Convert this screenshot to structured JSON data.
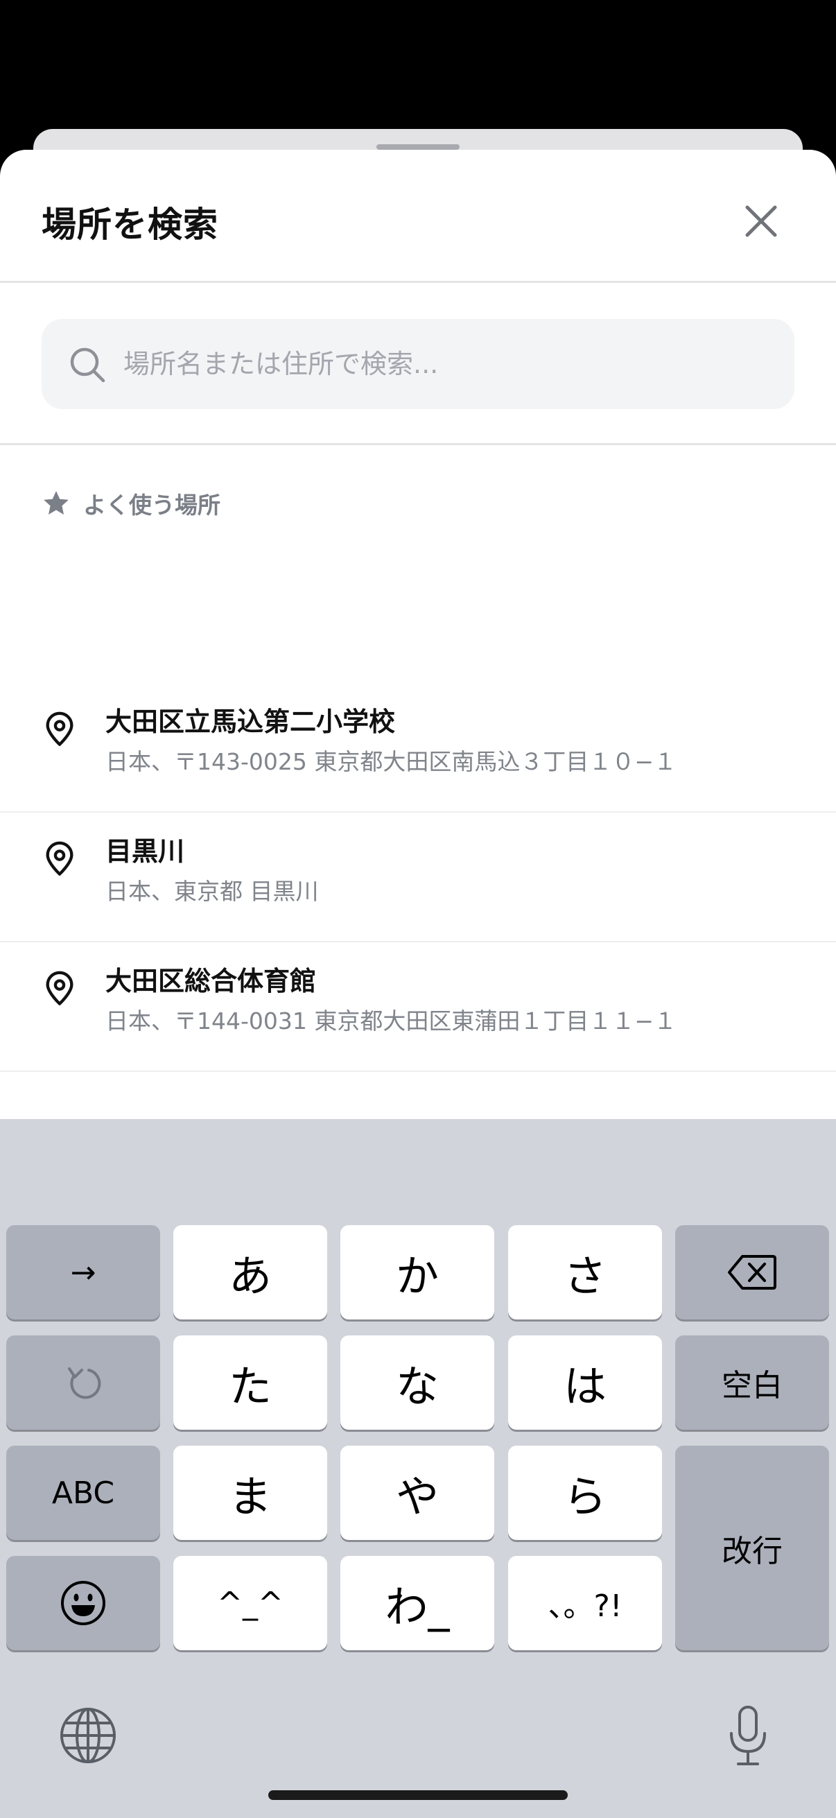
{
  "sheet": {
    "title": "場所を検索",
    "close_icon": "close-icon"
  },
  "search": {
    "placeholder": "場所名または住所で検索...",
    "value": "",
    "icon": "search-icon"
  },
  "favorites": {
    "header_icon": "star-icon",
    "header_label": "よく使う場所",
    "items": [
      {
        "icon": "map-pin-icon",
        "name": "大田区立馬込第二小学校",
        "address": "日本、〒143-0025 東京都大田区南馬込３丁目１０−１"
      },
      {
        "icon": "map-pin-icon",
        "name": "目黒川",
        "address": "日本、東京都 目黒川"
      },
      {
        "icon": "map-pin-icon",
        "name": "大田区総合体育館",
        "address": "日本、〒144-0031 東京都大田区東蒲田１丁目１１−１"
      }
    ]
  },
  "keyboard": {
    "keys": {
      "next": "→",
      "a": "あ",
      "ka": "か",
      "sa": "さ",
      "delete_icon": "backspace-icon",
      "undo_icon": "undo-icon",
      "ta": "た",
      "na": "な",
      "ha": "は",
      "space": "空白",
      "abc": "ABC",
      "ma": "ま",
      "ya": "や",
      "ra": "ら",
      "enter": "改行",
      "emoji_icon": "emoji-icon",
      "kaomoji": "^_^",
      "wa": "わ_",
      "punct": "、。?!",
      "globe_icon": "globe-icon",
      "mic_icon": "microphone-icon"
    }
  }
}
